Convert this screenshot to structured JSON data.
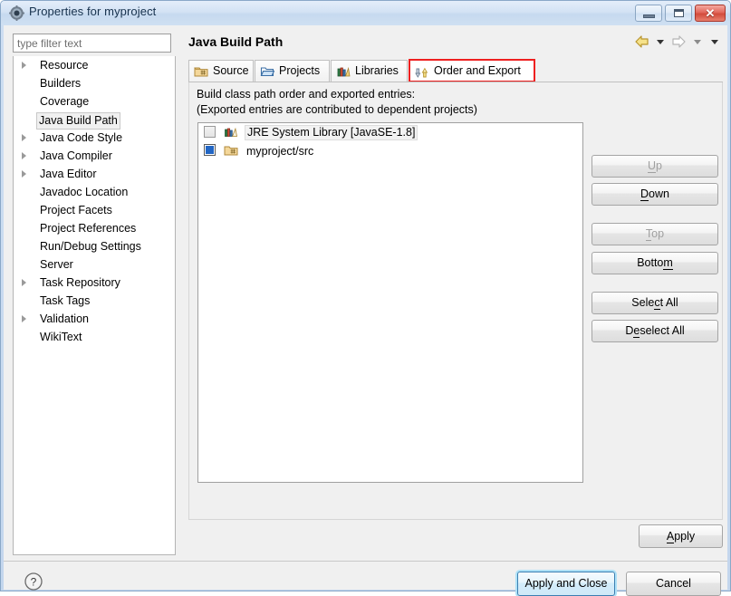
{
  "window": {
    "title": "Properties for myproject",
    "icon": "eclipse-properties-icon",
    "controls": {
      "minimize": "minimize-icon",
      "maximize": "maximize-icon",
      "close": "✕"
    }
  },
  "sidebar": {
    "filter": {
      "placeholder": "type filter text",
      "value": ""
    },
    "items": [
      {
        "label": "Resource",
        "expandable": true,
        "selected": false
      },
      {
        "label": "Builders",
        "expandable": false,
        "selected": false
      },
      {
        "label": "Coverage",
        "expandable": false,
        "selected": false
      },
      {
        "label": "Java Build Path",
        "expandable": false,
        "selected": true
      },
      {
        "label": "Java Code Style",
        "expandable": true,
        "selected": false
      },
      {
        "label": "Java Compiler",
        "expandable": true,
        "selected": false
      },
      {
        "label": "Java Editor",
        "expandable": true,
        "selected": false
      },
      {
        "label": "Javadoc Location",
        "expandable": false,
        "selected": false
      },
      {
        "label": "Project Facets",
        "expandable": false,
        "selected": false
      },
      {
        "label": "Project References",
        "expandable": false,
        "selected": false
      },
      {
        "label": "Run/Debug Settings",
        "expandable": false,
        "selected": false
      },
      {
        "label": "Server",
        "expandable": false,
        "selected": false
      },
      {
        "label": "Task Repository",
        "expandable": true,
        "selected": false
      },
      {
        "label": "Task Tags",
        "expandable": false,
        "selected": false
      },
      {
        "label": "Validation",
        "expandable": true,
        "selected": false
      },
      {
        "label": "WikiText",
        "expandable": false,
        "selected": false
      }
    ]
  },
  "page": {
    "title": "Java Build Path",
    "nav": {
      "back": "back-arrow-icon",
      "back_menu": "chevron-down-icon",
      "forward": "forward-arrow-icon",
      "forward_menu": "chevron-down-icon",
      "view_menu": "chevron-down-icon"
    },
    "tabs": [
      {
        "label": "Source",
        "icon": "source-folder-icon",
        "active": false
      },
      {
        "label": "Projects",
        "icon": "projects-icon",
        "active": false
      },
      {
        "label": "Libraries",
        "icon": "libraries-icon",
        "active": false
      },
      {
        "label": "Order and Export",
        "icon": "order-export-icon",
        "active": true
      }
    ],
    "description_line1": "Build class path order and exported entries:",
    "description_line2": "(Exported entries are contributed to dependent projects)",
    "entries": [
      {
        "label": "JRE System Library [JavaSE-1.8]",
        "icon": "jre-library-icon",
        "checked": false,
        "selected": true
      },
      {
        "label": "myproject/src",
        "icon": "source-folder-icon",
        "checked": true,
        "selected": false
      }
    ],
    "side_buttons": [
      {
        "label_pre": "",
        "mnemonic": "U",
        "label_post": "p",
        "disabled": true
      },
      {
        "label_pre": "",
        "mnemonic": "D",
        "label_post": "own",
        "disabled": false
      },
      {
        "label_pre": "",
        "mnemonic": "T",
        "label_post": "op",
        "disabled": true
      },
      {
        "label_pre": "Botto",
        "mnemonic": "m",
        "label_post": "",
        "disabled": false
      },
      {
        "label_pre": "Sele",
        "mnemonic": "c",
        "label_post": "t All",
        "disabled": false
      },
      {
        "label_pre": "D",
        "mnemonic": "e",
        "label_post": "select All",
        "disabled": false
      }
    ],
    "apply_button": {
      "label_pre": "",
      "mnemonic": "A",
      "label_post": "pply"
    }
  },
  "footer": {
    "help_icon": "help-question-icon",
    "apply_and_close": "Apply and Close",
    "cancel": "Cancel"
  },
  "colors": {
    "accent_red": "#ee2020",
    "focus_blue": "#3c7fb1",
    "checkbox_blue": "#2266c4",
    "titlebar_blue": "#c6d9ef",
    "close_red": "#d24b3c"
  }
}
